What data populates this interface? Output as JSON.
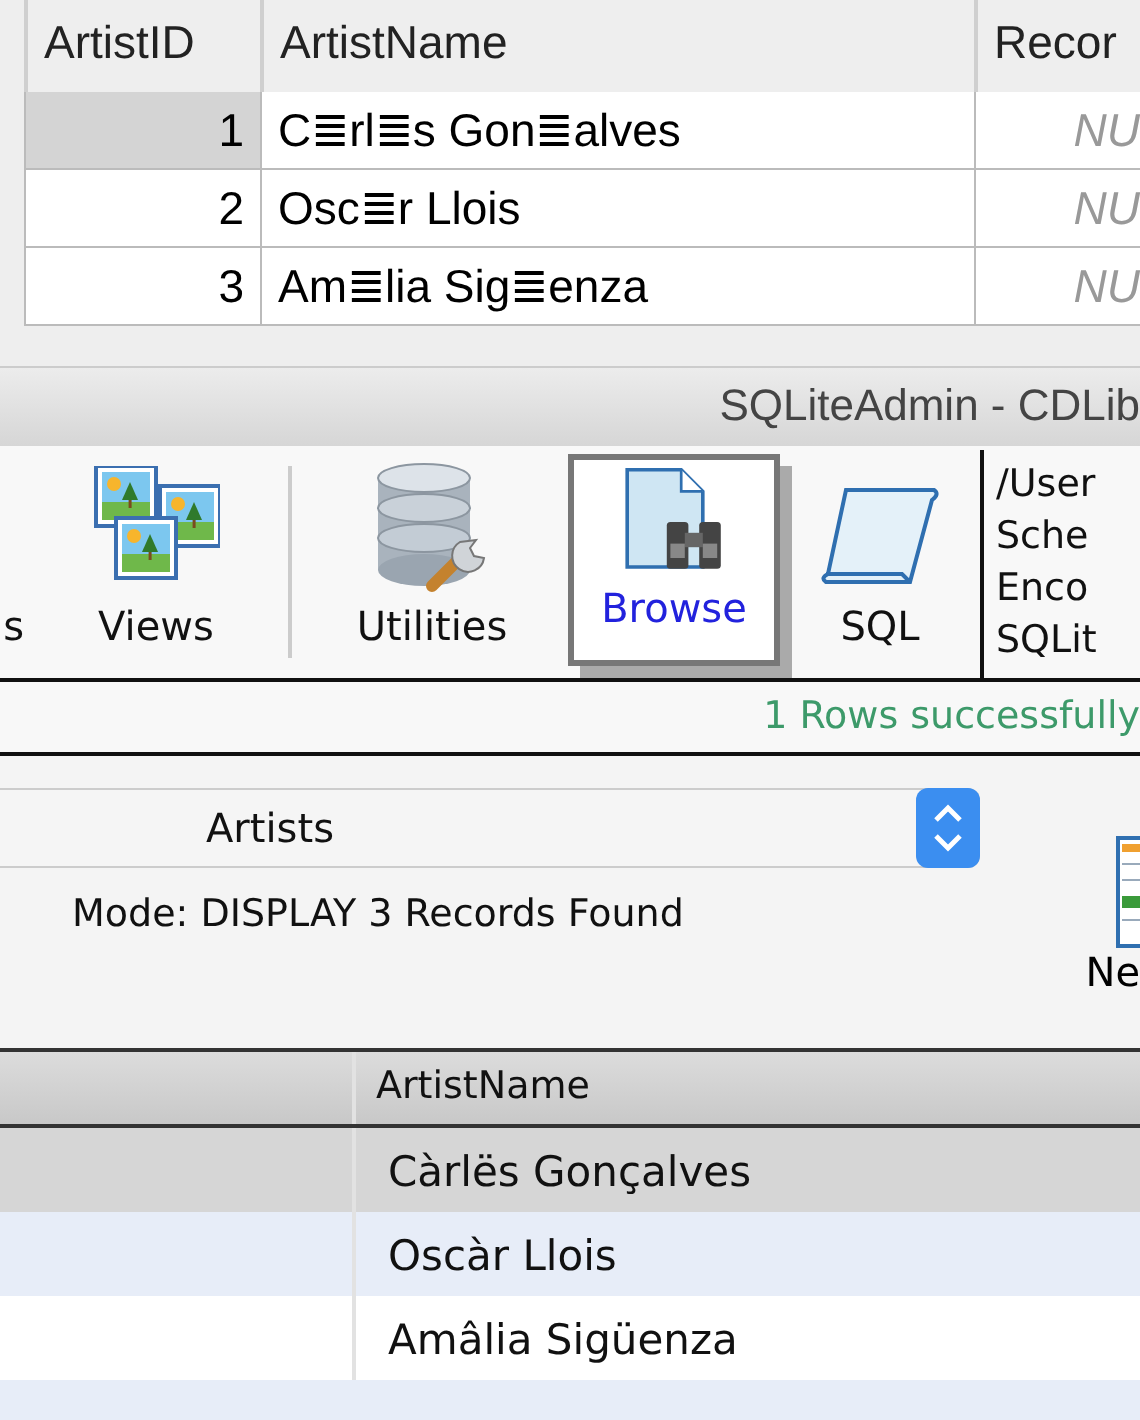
{
  "top_table": {
    "columns": [
      "ArtistID",
      "ArtistName",
      "Recor"
    ],
    "rows": [
      {
        "id": "1",
        "name": "C≣rl≣s Gon≣alves",
        "column_3": "NU",
        "selected": true
      },
      {
        "id": "2",
        "name": "Osc≣r Llois",
        "column_3": "NU",
        "selected": false
      },
      {
        "id": "3",
        "name": "Am≣lia Sig≣enza",
        "column_3": "NU",
        "selected": false
      }
    ]
  },
  "window": {
    "title": "SQLiteAdmin - CDLib"
  },
  "toolbar": {
    "items": [
      {
        "label": "s",
        "kind": "plain",
        "selected": false
      },
      {
        "label": "Views",
        "kind": "views",
        "selected": false
      },
      {
        "label": "Utilities",
        "kind": "utilities",
        "selected": false
      },
      {
        "label": "Browse",
        "kind": "browse",
        "selected": true
      },
      {
        "label": "SQL",
        "kind": "sql",
        "selected": false
      }
    ],
    "info_lines": [
      "/User",
      "Sche",
      "Enco",
      "SQLit"
    ]
  },
  "status_bar": {
    "message": "1 Rows successfully"
  },
  "table_select": {
    "value": "Artists"
  },
  "mode_text": "Mode: DISPLAY 3 Records Found",
  "new_button": {
    "label": "Ne"
  },
  "bottom_table": {
    "columns": [
      "ArtistName"
    ],
    "rows": [
      {
        "name": "Càrlës Gonçalves",
        "selected": true
      },
      {
        "name": "Oscàr Llois",
        "selected": false
      },
      {
        "name": "Amâlia Sigüenza",
        "selected": false
      }
    ]
  }
}
